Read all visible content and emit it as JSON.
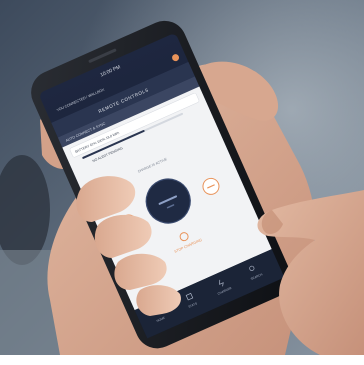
{
  "phone": {
    "status_time": "10:00 PM",
    "app_header": "YOU CONNECTED / WALLBOX",
    "section_title": "REMOTE CONTROLS",
    "tab_label": "AUTO CONNECT & SYNC",
    "charger_info": "BATTERY 62% 100% 18.8 kWh",
    "charger_status": "NO ALERT PENDING",
    "center_hint": "CHARGE IS ACTIVE",
    "action_label": "STOP CHARGING",
    "bottom_nav": [
      "HOME",
      "STATS",
      "CHARGER",
      "SEARCH"
    ]
  },
  "colors": {
    "screen_dark": "#1b2437",
    "header_bar": "#2a3550",
    "accent_orange": "#e9935a",
    "panel_light": "#f2f3f5"
  }
}
